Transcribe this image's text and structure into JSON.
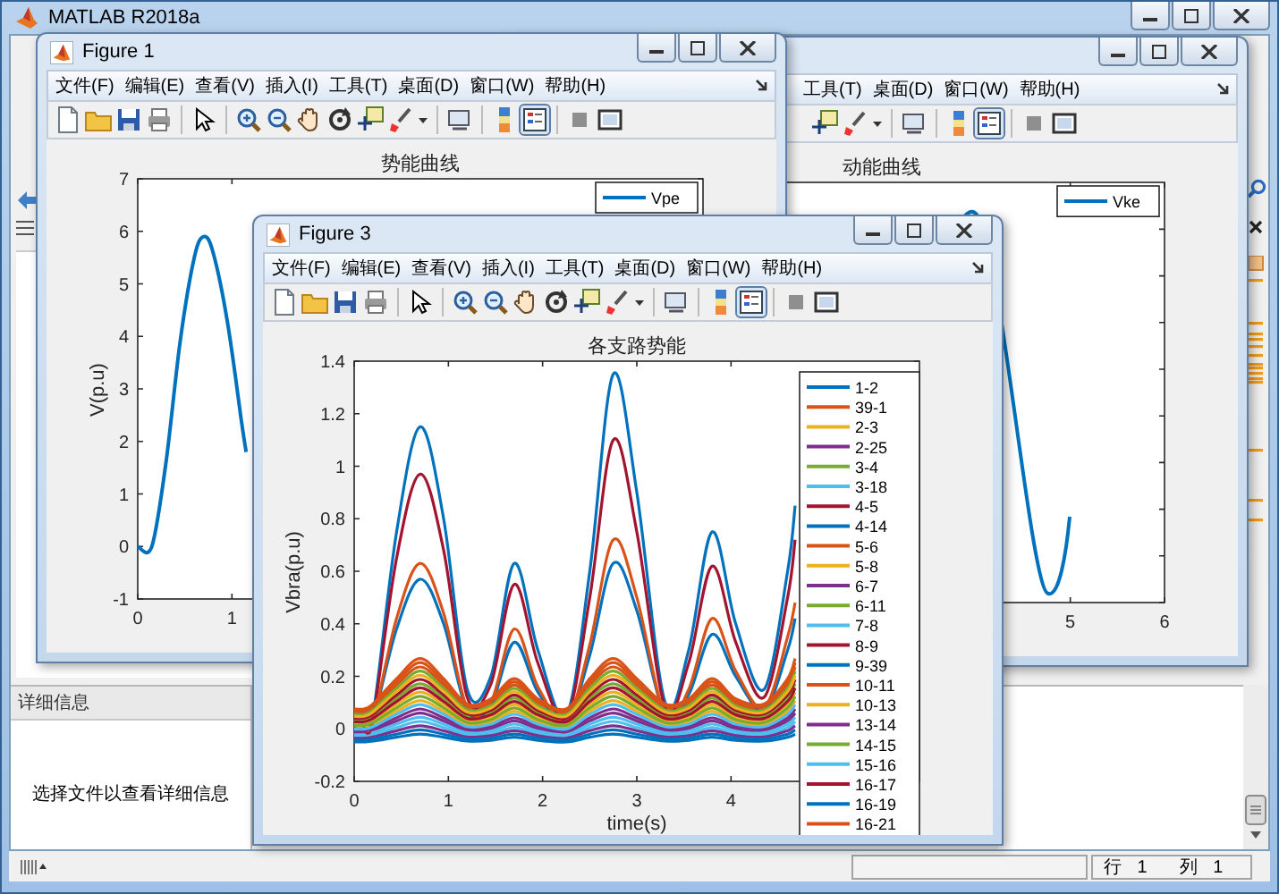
{
  "main_window": {
    "title": "MATLAB R2018a"
  },
  "figures": [
    {
      "menu": [
        "工具(T)",
        "桌面(D)",
        "窗口(W)",
        "帮助(H)"
      ],
      "toolbar": {
        "legend_on": true
      },
      "plot": {
        "kind": "sketch",
        "title": "动能曲线",
        "legend": [
          "Vke"
        ],
        "xtick_labels": [
          "5",
          "6"
        ]
      }
    },
    {
      "title": "Figure 1",
      "menu": [
        "文件(F)",
        "编辑(E)",
        "查看(V)",
        "插入(I)",
        "工具(T)",
        "桌面(D)",
        "窗口(W)",
        "帮助(H)"
      ],
      "toolbar": {
        "legend_on": true
      },
      "plot": {
        "kind": "chart",
        "chart_data": {
          "type": "line",
          "title": "势能曲线",
          "ylabel": "V(p.u)",
          "x": [
            0,
            0.15,
            0.3,
            0.45,
            0.6,
            0.7,
            0.8,
            0.95,
            1.1,
            1.15
          ],
          "series": [
            {
              "name": "Vpe",
              "color": "#0072bd",
              "values": [
                0,
                0,
                1.6,
                3.9,
                5.5,
                5.9,
                5.6,
                4.3,
                2.4,
                1.8
              ]
            }
          ],
          "legend": "upper right",
          "xlim": [
            0,
            6
          ],
          "ylim": [
            -1,
            7
          ],
          "xticks": [
            0,
            1
          ],
          "yticks": [
            -1,
            0,
            1,
            2,
            3,
            4,
            5,
            6,
            7
          ]
        }
      }
    },
    {
      "title": "Figure 3",
      "menu": [
        "文件(F)",
        "编辑(E)",
        "查看(V)",
        "插入(I)",
        "工具(T)",
        "桌面(D)",
        "窗口(W)",
        "帮助(H)"
      ],
      "toolbar": {
        "legend_on": true
      },
      "plot": {
        "kind": "chart",
        "chart_data": {
          "type": "line",
          "title": "各支路势能",
          "xlabel": "time(s)",
          "ylabel": "Vbra(p.u)",
          "x": [
            0,
            0.1,
            0.2,
            0.45,
            0.7,
            0.95,
            1.2,
            1.45,
            1.7,
            1.95,
            2.25,
            2.5,
            2.75,
            3.0,
            3.3,
            3.55,
            3.8,
            4.05,
            4.35,
            4.6,
            4.68
          ],
          "series": [
            {
              "name": "1-2",
              "color": "#0072bd",
              "values": [
                0,
                0,
                0.05,
                0.75,
                1.15,
                0.8,
                0.15,
                0.2,
                0.63,
                0.3,
                0.05,
                0.6,
                1.35,
                0.9,
                0.1,
                0.3,
                0.75,
                0.4,
                0.15,
                0.6,
                0.85
              ]
            },
            {
              "name": "39-1",
              "color": "#d95319",
              "values": [
                0.062,
                0.062,
                0.079,
                0.166,
                0.236,
                0.166,
                0.079,
                0.097,
                0.166,
                0.097,
                0.062,
                0.166,
                0.236,
                0.166,
                0.079,
                0.097,
                0.166,
                0.097,
                0.079,
                0.166,
                0.236
              ]
            },
            {
              "name": "2-3",
              "color": "#edb120",
              "values": [
                0.006,
                0.006,
                0.016,
                0.067,
                0.108,
                0.067,
                0.016,
                0.026,
                0.067,
                0.026,
                0.006,
                0.067,
                0.108,
                0.067,
                0.016,
                0.026,
                0.067,
                0.026,
                0.016,
                0.067,
                0.108
              ]
            },
            {
              "name": "2-25",
              "color": "#7e2f8e",
              "values": [
                -0.015,
                -0.015,
                -0.008,
                0.03,
                0.06,
                0.03,
                -0.008,
                0,
                0.03,
                0,
                -0.015,
                0.03,
                0.06,
                0.03,
                -0.008,
                0,
                0.03,
                0,
                -0.008,
                0.03,
                0.06
              ]
            },
            {
              "name": "3-4",
              "color": "#77ac30",
              "values": [
                0.034,
                0.034,
                0.048,
                0.117,
                0.172,
                0.117,
                0.048,
                0.062,
                0.117,
                0.062,
                0.034,
                0.117,
                0.172,
                0.117,
                0.048,
                0.062,
                0.117,
                0.062,
                0.048,
                0.117,
                0.172
              ]
            },
            {
              "name": "3-18",
              "color": "#4dbeee",
              "values": [
                -0.022,
                -0.022,
                -0.015,
                0.018,
                0.044,
                0.018,
                -0.015,
                -0.009,
                0.018,
                -0.009,
                -0.022,
                0.018,
                0.044,
                0.018,
                -0.015,
                -0.009,
                0.018,
                -0.009,
                -0.015,
                0.018,
                0.044
              ]
            },
            {
              "name": "4-5",
              "color": "#a2142f",
              "values": [
                0,
                0,
                0.04,
                0.65,
                0.97,
                0.68,
                0.12,
                0.17,
                0.55,
                0.25,
                0.04,
                0.5,
                1.1,
                0.75,
                0.08,
                0.25,
                0.62,
                0.33,
                0.12,
                0.5,
                0.72
              ]
            },
            {
              "name": "4-14",
              "color": "#0072bd",
              "values": [
                0,
                0,
                0.03,
                0.38,
                0.57,
                0.4,
                0.07,
                0.09,
                0.33,
                0.14,
                0.03,
                0.28,
                0.63,
                0.45,
                0.05,
                0.13,
                0.36,
                0.2,
                0.07,
                0.3,
                0.42
              ]
            },
            {
              "name": "5-6",
              "color": "#d95319",
              "values": [
                0,
                0,
                0.03,
                0.42,
                0.63,
                0.44,
                0.08,
                0.1,
                0.38,
                0.16,
                0.03,
                0.32,
                0.72,
                0.5,
                0.05,
                0.15,
                0.42,
                0.22,
                0.08,
                0.35,
                0.48
              ]
            },
            {
              "name": "5-8",
              "color": "#edb120",
              "values": [
                0.02,
                0.02,
                0.032,
                0.092,
                0.14,
                0.092,
                0.032,
                0.044,
                0.092,
                0.044,
                0.02,
                0.092,
                0.14,
                0.092,
                0.032,
                0.044,
                0.092,
                0.044,
                0.032,
                0.092,
                0.14
              ]
            },
            {
              "name": "6-7",
              "color": "#7e2f8e",
              "values": [
                -0.008,
                -0.008,
                0,
                0.042,
                0.076,
                0.042,
                0,
                0.009,
                0.042,
                0.009,
                -0.008,
                0.042,
                0.076,
                0.042,
                0,
                0.009,
                0.042,
                0.009,
                0,
                0.042,
                0.076
              ]
            },
            {
              "name": "6-11",
              "color": "#77ac30",
              "values": [
                0.055,
                0.055,
                0.072,
                0.154,
                0.22,
                0.154,
                0.072,
                0.088,
                0.154,
                0.088,
                0.055,
                0.154,
                0.22,
                0.154,
                0.072,
                0.088,
                0.154,
                0.088,
                0.072,
                0.154,
                0.22
              ]
            },
            {
              "name": "7-8",
              "color": "#4dbeee",
              "values": [
                -0.029,
                -0.029,
                -0.023,
                0.005,
                0.028,
                0.005,
                -0.023,
                -0.018,
                0.005,
                -0.018,
                -0.029,
                0.005,
                0.028,
                0.005,
                -0.023,
                -0.018,
                0.005,
                -0.018,
                -0.023,
                0.005,
                0.028
              ]
            },
            {
              "name": "8-9",
              "color": "#a2142f",
              "values": [
                0.041,
                0.041,
                0.056,
                0.129,
                0.188,
                0.129,
                0.056,
                0.07,
                0.129,
                0.07,
                0.041,
                0.129,
                0.188,
                0.129,
                0.056,
                0.07,
                0.129,
                0.07,
                0.056,
                0.129,
                0.188
              ]
            },
            {
              "name": "9-39",
              "color": "#0072bd",
              "values": [
                -0.05,
                -0.05,
                -0.047,
                -0.032,
                -0.02,
                -0.032,
                -0.047,
                -0.044,
                -0.032,
                -0.044,
                -0.05,
                -0.032,
                -0.02,
                -0.032,
                -0.047,
                -0.044,
                -0.032,
                -0.044,
                -0.047,
                -0.032,
                -0.02
              ]
            },
            {
              "name": "10-11",
              "color": "#d95319",
              "values": [
                0.076,
                0.076,
                0.095,
                0.191,
                0.268,
                0.191,
                0.095,
                0.114,
                0.191,
                0.114,
                0.076,
                0.191,
                0.268,
                0.191,
                0.095,
                0.114,
                0.191,
                0.114,
                0.095,
                0.191,
                0.268
              ]
            },
            {
              "name": "10-13",
              "color": "#edb120",
              "values": [
                0.048,
                0.048,
                0.064,
                0.142,
                0.204,
                0.142,
                0.064,
                0.079,
                0.142,
                0.079,
                0.048,
                0.142,
                0.204,
                0.142,
                0.064,
                0.079,
                0.142,
                0.079,
                0.064,
                0.142,
                0.204
              ]
            },
            {
              "name": "13-14",
              "color": "#7e2f8e",
              "values": [
                -0.036,
                -0.036,
                -0.031,
                -0.007,
                0.012,
                -0.007,
                -0.031,
                -0.026,
                -0.007,
                -0.026,
                -0.036,
                -0.007,
                0.012,
                -0.007,
                -0.031,
                -0.026,
                -0.007,
                -0.026,
                -0.031,
                -0.007,
                0.012
              ]
            },
            {
              "name": "14-15",
              "color": "#77ac30",
              "values": [
                0.013,
                0.013,
                0.024,
                0.08,
                0.124,
                0.08,
                0.024,
                0.035,
                0.08,
                0.035,
                0.013,
                0.08,
                0.124,
                0.08,
                0.024,
                0.035,
                0.08,
                0.035,
                0.024,
                0.08,
                0.124
              ]
            },
            {
              "name": "15-16",
              "color": "#4dbeee",
              "values": [
                -0.001,
                -0.001,
                0.008,
                0.055,
                0.092,
                0.055,
                0.008,
                0.018,
                0.055,
                0.018,
                -0.001,
                0.055,
                0.092,
                0.055,
                0.008,
                0.018,
                0.055,
                0.018,
                0.008,
                0.055,
                0.092
              ]
            },
            {
              "name": "16-17",
              "color": "#a2142f",
              "values": [
                0.027,
                0.027,
                0.04,
                0.104,
                0.156,
                0.104,
                0.04,
                0.053,
                0.104,
                0.053,
                0.027,
                0.104,
                0.156,
                0.104,
                0.04,
                0.053,
                0.104,
                0.053,
                0.04,
                0.104,
                0.156
              ]
            },
            {
              "name": "16-19",
              "color": "#0072bd",
              "values": [
                -0.043,
                -0.043,
                -0.039,
                -0.02,
                -0.004,
                -0.02,
                -0.039,
                -0.035,
                -0.02,
                -0.035,
                -0.043,
                -0.02,
                -0.004,
                -0.02,
                -0.039,
                -0.035,
                -0.02,
                -0.035,
                -0.039,
                -0.02,
                -0.004
              ]
            },
            {
              "name": "16-21",
              "color": "#d95319",
              "values": [
                0.069,
                0.069,
                0.087,
                0.179,
                0.252,
                0.179,
                0.087,
                0.106,
                0.179,
                0.106,
                0.069,
                0.179,
                0.252,
                0.179,
                0.087,
                0.106,
                0.179,
                0.106,
                0.087,
                0.179,
                0.252
              ]
            }
          ],
          "legend": "right",
          "xlim": [
            0,
            6
          ],
          "ylim": [
            -0.2,
            1.4
          ],
          "xticks": [
            0,
            1,
            2,
            3,
            4
          ],
          "yticks": [
            -0.2,
            0,
            0.2,
            0.4,
            0.6,
            0.8,
            1,
            1.2,
            1.4
          ]
        }
      }
    }
  ],
  "details_panel": {
    "header": "详细信息",
    "message": "选择文件以查看详细信息"
  },
  "status_bar": {
    "line": "行 1",
    "column": "列 1"
  }
}
